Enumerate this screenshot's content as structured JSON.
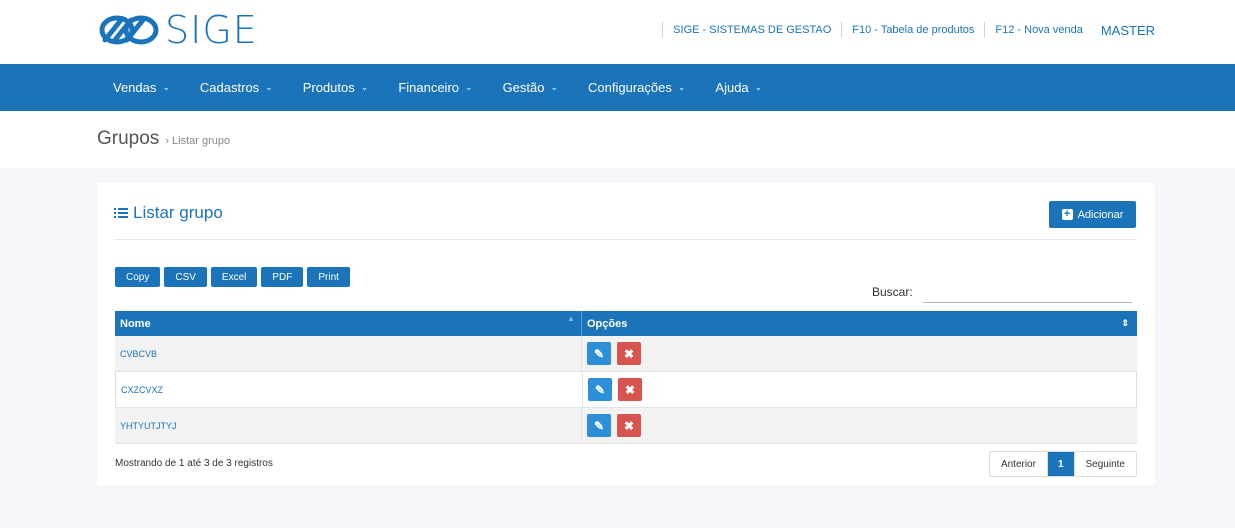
{
  "header": {
    "logo_text": "SIGE",
    "links": [
      {
        "label": "SIGE - SISTEMAS DE GESTAO"
      },
      {
        "label": "F10 - Tabela de produtos"
      },
      {
        "label": "F12 - Nova venda"
      }
    ],
    "user": "MASTER"
  },
  "nav": {
    "items": [
      {
        "label": "Vendas"
      },
      {
        "label": "Cadastros"
      },
      {
        "label": "Produtos"
      },
      {
        "label": "Financeiro"
      },
      {
        "label": "Gestão"
      },
      {
        "label": "Configurações"
      },
      {
        "label": "Ajuda"
      }
    ],
    "chevron": "⌄"
  },
  "breadcrumb": {
    "title": "Grupos",
    "separator": "›",
    "sub": "Listar grupo"
  },
  "card": {
    "title": "Listar grupo",
    "add_label": "Adicionar",
    "export_buttons": [
      "Copy",
      "CSV",
      "Excel",
      "PDF",
      "Print"
    ],
    "search_label": "Buscar:",
    "search_value": ""
  },
  "table": {
    "columns": [
      "Nome",
      "Opções"
    ],
    "rows": [
      {
        "name": "CVBCVB"
      },
      {
        "name": "CXZCVXZ"
      },
      {
        "name": "YHTYUTJTYJ"
      }
    ],
    "info": "Mostrando de 1 até 3 de 3 registros"
  },
  "pagination": {
    "prev": "Anterior",
    "current": "1",
    "next": "Seguinte"
  },
  "colors": {
    "primary": "#1b73b9",
    "edit": "#2c8fd7",
    "delete": "#d9534f"
  }
}
